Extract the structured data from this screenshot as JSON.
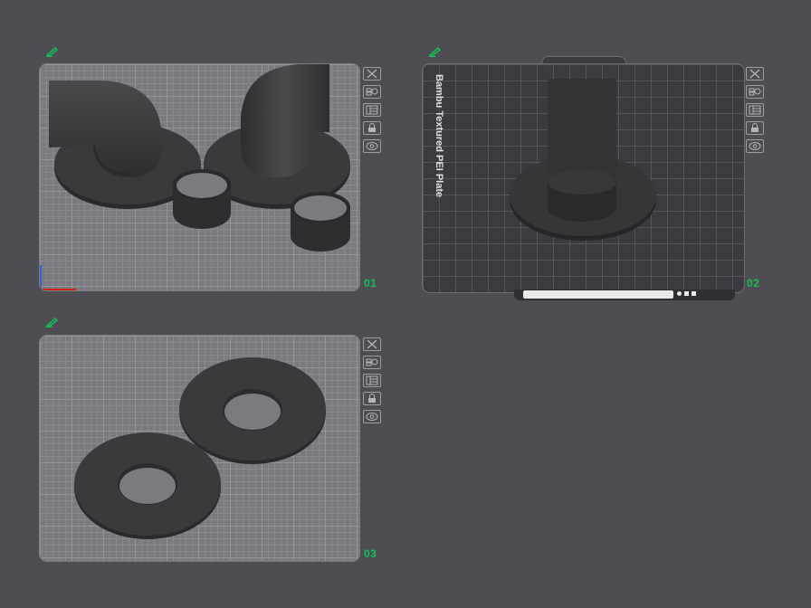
{
  "plates": [
    {
      "number": "01"
    },
    {
      "number": "02",
      "bed_label": "Bambu Textured PEI Plate"
    },
    {
      "number": "03"
    }
  ],
  "toolbar_icons": [
    "close-icon",
    "auto-arrange-icon",
    "plate-settings-icon",
    "lock-icon",
    "eye-icon"
  ],
  "colors": {
    "background": "#4e4d53",
    "plate_light": "#7b7a80",
    "plate_dark": "#3b3a3f",
    "accent_green": "#13c05a",
    "part": "#3a3a3c"
  }
}
